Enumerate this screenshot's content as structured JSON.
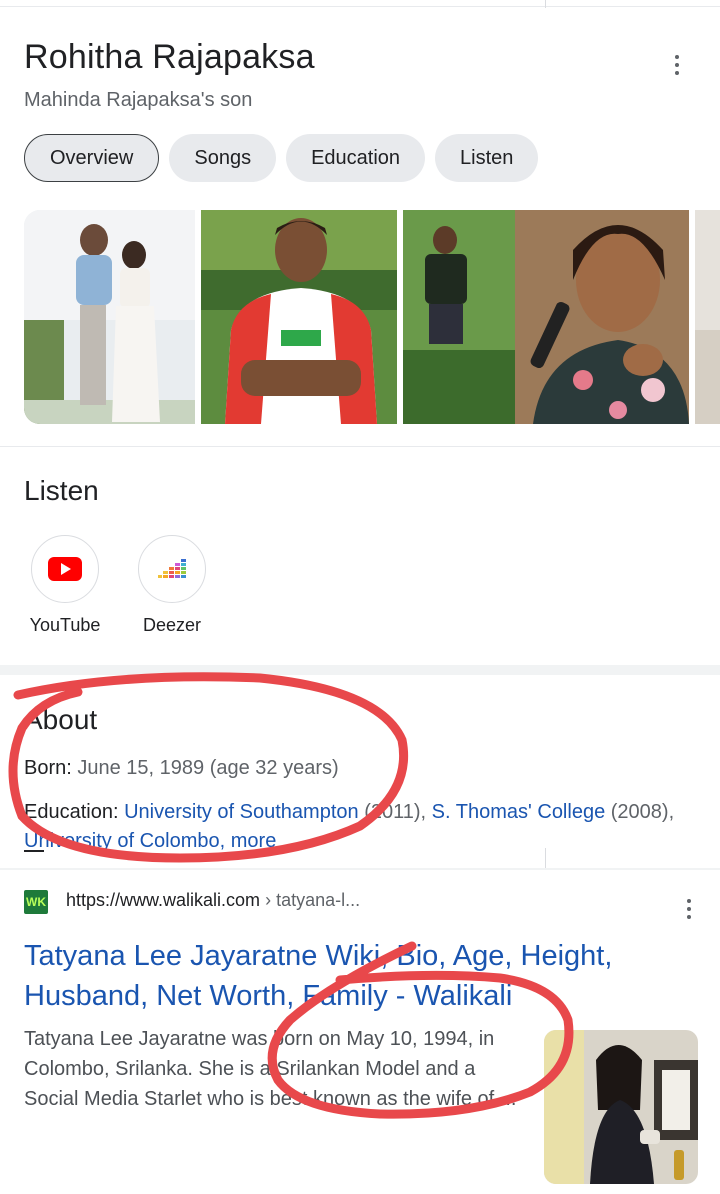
{
  "entity": {
    "title": "Rohitha Rajapaksa",
    "subtitle": "Mahinda Rajapaksa's son"
  },
  "tabs": [
    "Overview",
    "Songs",
    "Education",
    "Listen"
  ],
  "listen": {
    "heading": "Listen",
    "services": [
      {
        "label": "YouTube",
        "icon": "youtube-icon"
      },
      {
        "label": "Deezer",
        "icon": "deezer-icon"
      }
    ]
  },
  "about": {
    "heading": "About",
    "born_label": "Born:",
    "born_value": "June 15, 1989 (age 32 years)",
    "education_label": "Education:",
    "education_items": [
      {
        "name": "University of Southampton",
        "year": "(2011),"
      },
      {
        "name": "S. Thomas' College",
        "year": "(2008),"
      }
    ],
    "education_line2": "University of Colombo,",
    "more_label": "more"
  },
  "result": {
    "url": "https://www.walikali.com",
    "breadcrumb": "› tatyana-l...",
    "favicon_text": "WK",
    "title": "Tatyana Lee Jayaratne Wiki, Bio, Age, Height, Husband, Net Worth, Family - Walikali",
    "snippet": "Tatyana Lee Jayaratne was born on May 10, 1994, in Colombo, Srilanka. She is a Srilankan Model and a Social Media Starlet who is best known as the wife of ..."
  },
  "colors": {
    "link": "#1a55b0",
    "annotation": "#e8484b",
    "youtube": "#ff0000"
  }
}
